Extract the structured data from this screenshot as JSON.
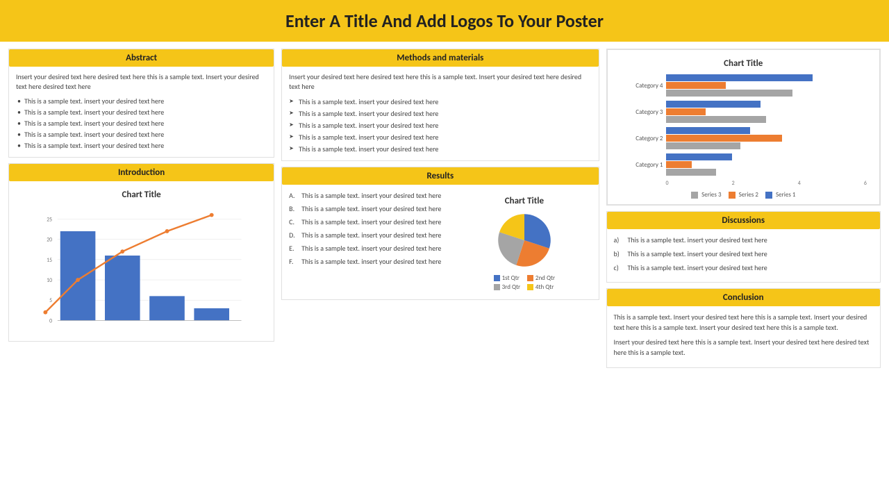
{
  "header": {
    "title": "Enter A Title And Add Logos To Your Poster"
  },
  "abstract": {
    "section_label": "Abstract",
    "intro": "Insert your desired text here desired text here this is a sample text. Insert your desired text here desired text here",
    "bullets": [
      "This is a sample text. insert your desired text here",
      "This is a sample text. insert your desired text here",
      "This is a sample text. insert your desired text here",
      "This is a sample text. insert your desired text here",
      "This is a sample text. insert your desired text here"
    ]
  },
  "methods": {
    "section_label": "Methods and materials",
    "intro": "Insert your desired text here desired text here this is a sample text. Insert your desired text here desired text here",
    "bullets": [
      "This is a sample text. insert your desired text here",
      "This is a sample text. insert your desired text here",
      "This is a sample text. insert your desired text here",
      "This is a sample text. insert your desired text here",
      "This is a sample text. insert your desired text here"
    ]
  },
  "introduction": {
    "section_label": "Introduction",
    "chart_title": "Chart Title",
    "bar_data": [
      22,
      16,
      6,
      3
    ],
    "line_data": [
      2,
      10,
      17,
      22,
      26
    ],
    "y_axis": [
      0,
      5,
      10,
      15,
      20,
      25
    ]
  },
  "results": {
    "section_label": "Results",
    "items": [
      "A.",
      "B.",
      "C.",
      "D.",
      "E.",
      "F."
    ],
    "item_text": "This is a sample text. insert your desired text here",
    "chart_title": "Chart Title",
    "pie": {
      "segments": [
        {
          "label": "1st Qtr",
          "color": "#4472C4",
          "value": 30,
          "start": 0,
          "end": 108
        },
        {
          "label": "2nd Qtr",
          "color": "#ED7D31",
          "value": 25,
          "start": 108,
          "end": 198
        },
        {
          "label": "3rd Qtr",
          "color": "#A5A5A5",
          "value": 25,
          "start": 198,
          "end": 288
        },
        {
          "label": "4th Qtr",
          "color": "#F5C518",
          "value": 20,
          "start": 288,
          "end": 360
        }
      ]
    }
  },
  "chart_right": {
    "title": "Chart Title",
    "categories": [
      "Category 4",
      "Category 3",
      "Category 2",
      "Category 1"
    ],
    "series": [
      {
        "name": "Series 1",
        "color": "#4472C4",
        "values": [
          4.4,
          2.8,
          2.5,
          2.0
        ]
      },
      {
        "name": "Series 2",
        "color": "#ED7D31",
        "values": [
          1.8,
          1.2,
          3.5,
          0.8
        ]
      },
      {
        "name": "Series 3",
        "color": "#A5A5A5",
        "values": [
          3.8,
          3.0,
          2.2,
          1.5
        ]
      }
    ],
    "x_axis": [
      "0",
      "2",
      "4",
      "6"
    ]
  },
  "discussions": {
    "section_label": "Discussions",
    "items": [
      {
        "label": "a)",
        "text": "This is a sample text. insert your desired text here"
      },
      {
        "label": "b)",
        "text": "This is a sample text. insert your desired text here"
      },
      {
        "label": "c)",
        "text": "This is a sample text. insert your desired text here"
      }
    ]
  },
  "conclusion": {
    "section_label": "Conclusion",
    "text1": "This is a sample text. Insert your desired text here this is a sample text. Insert your desired text here this is a sample text. Insert your desired text here this is a sample text.",
    "text2": "Insert your desired text here this is a sample text. Insert your desired text here desired text here this is a sample text."
  }
}
